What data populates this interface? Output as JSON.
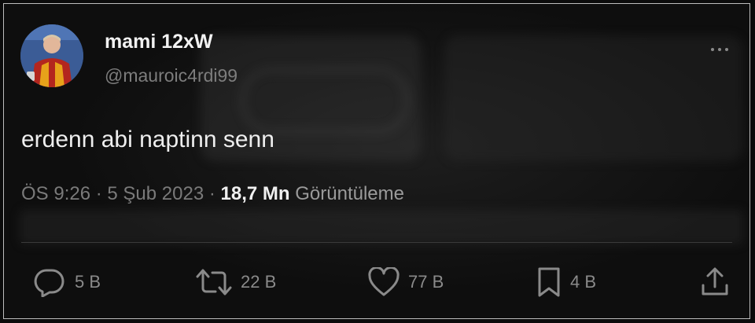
{
  "user": {
    "name": "mami 12xW",
    "handle": "@mauroic4rdi99",
    "avatar_icon": "profile-photo-player"
  },
  "tweet": {
    "text": "erdenn abi naptinn senn"
  },
  "meta": {
    "time": "ÖS 9:26",
    "separator": "·",
    "date": "5 Şub 2023",
    "views_count": "18,7 Mn",
    "views_label": "Görüntüleme"
  },
  "actions": {
    "reply_count": "5 B",
    "retweet_count": "22 B",
    "like_count": "77 B",
    "bookmark_count": "4 B"
  },
  "icons": {
    "more": "more-horizontal-icon",
    "reply": "reply-icon",
    "retweet": "retweet-icon",
    "like": "heart-icon",
    "bookmark": "bookmark-icon",
    "share": "share-icon"
  },
  "colors": {
    "background": "#0e0e0e",
    "text_primary": "#eeeeee",
    "text_secondary": "#7a7a7a",
    "border": "#bdbdbd"
  }
}
